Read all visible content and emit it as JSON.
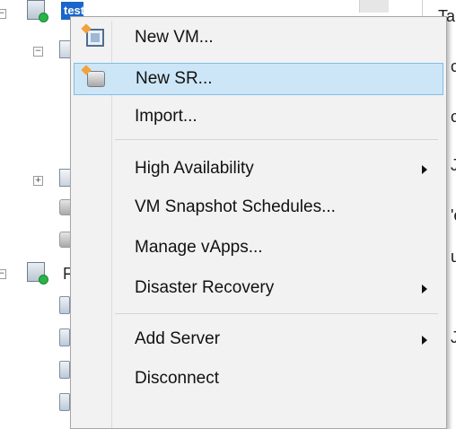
{
  "tree": {
    "selected_label": "test",
    "expander_collapse": "−",
    "expander_expand": "+",
    "partial_label": "F"
  },
  "right_pane": {
    "letters": [
      "Ta",
      "c",
      "c",
      "Jc",
      "'e",
      "ui",
      "",
      "",
      "J"
    ]
  },
  "context_menu": {
    "items": [
      {
        "label": "New VM...",
        "icon": "new-vm-icon",
        "submenu": false,
        "highlighted": false
      },
      {
        "label": "New SR...",
        "icon": "new-sr-icon",
        "submenu": false,
        "highlighted": true
      },
      {
        "label": "Import...",
        "icon": "",
        "submenu": false,
        "highlighted": false
      },
      {
        "label": "High Availability",
        "icon": "",
        "submenu": true,
        "highlighted": false
      },
      {
        "label": "VM Snapshot Schedules...",
        "icon": "",
        "submenu": false,
        "highlighted": false
      },
      {
        "label": "Manage vApps...",
        "icon": "",
        "submenu": false,
        "highlighted": false
      },
      {
        "label": "Disaster Recovery",
        "icon": "",
        "submenu": true,
        "highlighted": false
      },
      {
        "label": "Add Server",
        "icon": "",
        "submenu": true,
        "highlighted": false
      },
      {
        "label": "Disconnect",
        "icon": "",
        "submenu": false,
        "highlighted": false
      }
    ]
  },
  "colors": {
    "menu_background": "#f2f2f2",
    "highlight_background": "#cde6f7",
    "highlight_border": "#7fbde9",
    "tree_selection": "#1a66cc",
    "status_green": "#2bb34a"
  }
}
